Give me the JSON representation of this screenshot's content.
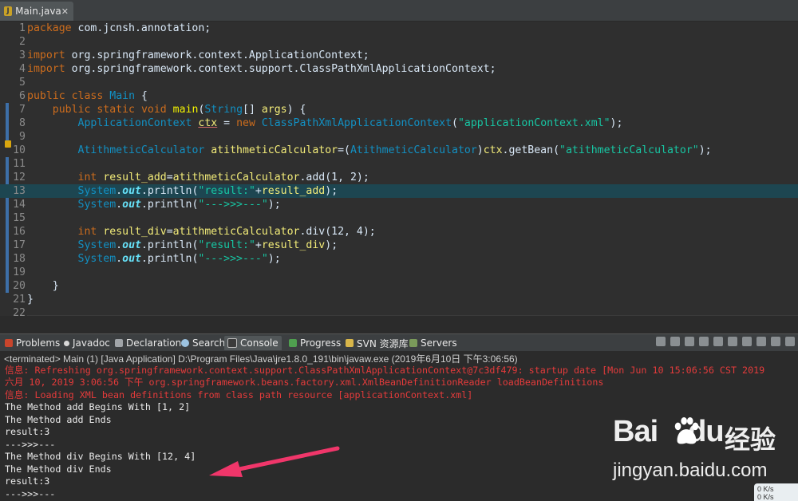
{
  "editor_tab": {
    "filename": "Main.java",
    "close": "✕"
  },
  "code_lines": [
    {
      "n": "1"
    },
    {
      "n": "2"
    },
    {
      "n": "3"
    },
    {
      "n": "4"
    },
    {
      "n": "5"
    },
    {
      "n": "6"
    },
    {
      "n": "7"
    },
    {
      "n": "8"
    },
    {
      "n": "9"
    },
    {
      "n": "10"
    },
    {
      "n": "11"
    },
    {
      "n": "12"
    },
    {
      "n": "13"
    },
    {
      "n": "14"
    },
    {
      "n": "15"
    },
    {
      "n": "16"
    },
    {
      "n": "17"
    },
    {
      "n": "18"
    },
    {
      "n": "19"
    },
    {
      "n": "20"
    },
    {
      "n": "21"
    },
    {
      "n": "22"
    }
  ],
  "code": {
    "l1": [
      "package",
      " com.jcnsh.annotation;"
    ],
    "l3": [
      "import",
      " org.springframework.context.ApplicationContext;"
    ],
    "l4": [
      "import",
      " org.springframework.context.support.ClassPathXmlApplicationContext;"
    ],
    "l6": [
      "public",
      " ",
      "class",
      " ",
      "Main",
      " {"
    ],
    "l7": [
      "    ",
      "public",
      " ",
      "static",
      " ",
      "void",
      " ",
      "main",
      "(",
      "String",
      "[] ",
      "args",
      ") {"
    ],
    "l8": [
      "        ",
      "ApplicationContext",
      " ",
      "ctx",
      " = ",
      "new",
      " ",
      "ClassPathXmlApplicationContext",
      "(",
      "\"applicationContext.xml\"",
      ");"
    ],
    "l10": [
      "        ",
      "AtithmeticCalculator",
      " ",
      "atithmeticCalculator",
      "=(",
      "AtithmeticCalculator",
      ")",
      "ctx",
      ".getBean(",
      "\"atithmeticCalculator\"",
      ");"
    ],
    "l12": [
      "        ",
      "int",
      " ",
      "result_add",
      "=",
      "atithmeticCalculator",
      ".add(1, 2);"
    ],
    "l13": [
      "        ",
      "System",
      ".",
      "out",
      ".println(",
      "\"result:\"",
      "+",
      "result_add",
      ");"
    ],
    "l14": [
      "        ",
      "System",
      ".",
      "out",
      ".println(",
      "\"--->>>---\"",
      ");"
    ],
    "l16": [
      "        ",
      "int",
      " ",
      "result_div",
      "=",
      "atithmeticCalculator",
      ".div(12, 4);"
    ],
    "l17": [
      "        ",
      "System",
      ".",
      "out",
      ".println(",
      "\"result:\"",
      "+",
      "result_div",
      ");"
    ],
    "l18": [
      "        ",
      "System",
      ".",
      "out",
      ".println(",
      "\"--->>>---\"",
      ");"
    ],
    "l20": [
      "    }"
    ],
    "l21": [
      "}"
    ]
  },
  "view_tabs": {
    "problems": "Problems",
    "javadoc": "Javadoc",
    "declaration": "Declaration",
    "search": "Search",
    "console": "Console",
    "progress": "Progress",
    "svn": "SVN 资源库",
    "servers": "Servers"
  },
  "console": {
    "terminated": "<terminated> Main (1) [Java Application] D:\\Program Files\\Java\\jre1.8.0_191\\bin\\javaw.exe (2019年6月10日 下午3:06:56)",
    "lines": [
      "信息: Refreshing org.springframework.context.support.ClassPathXmlApplicationContext@7c3df479: startup date [Mon Jun 10 15:06:56 CST 2019",
      "六月 10, 2019 3:06:56 下午 org.springframework.beans.factory.xml.XmlBeanDefinitionReader loadBeanDefinitions",
      "信息: Loading XML bean definitions from class path resource [applicationContext.xml]",
      "The Method add Begins With [1, 2]",
      "The Method add Ends",
      "result:3",
      "--->>>---",
      "The Method div Begins With [12, 4]",
      "The Method div Ends",
      "result:3",
      "--->>>---"
    ]
  },
  "watermark": {
    "brand": "Bai",
    "brand2": "du",
    "cn": "经验",
    "url": "jingyan.baidu.com"
  },
  "net_widget": {
    "up": "0  K/s",
    "down": "0  K/s"
  },
  "colors": {
    "arrow": "#f0366a",
    "console_err": "#e43b3b",
    "keyword": "#cc6c1d"
  }
}
